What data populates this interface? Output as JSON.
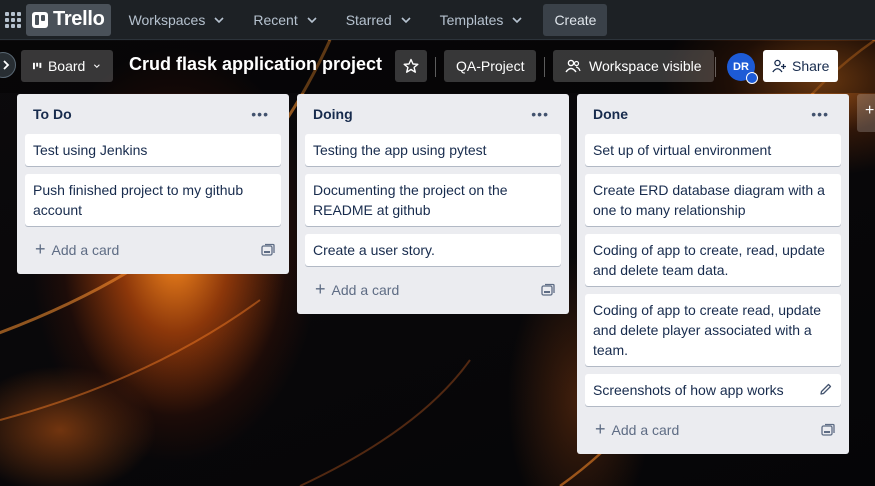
{
  "nav": {
    "logo": "Trello",
    "menus": [
      {
        "label": "Workspaces"
      },
      {
        "label": "Recent"
      },
      {
        "label": "Starred"
      },
      {
        "label": "Templates"
      }
    ],
    "create_label": "Create"
  },
  "board": {
    "view_label": "Board",
    "title": "Crud flask application project",
    "workspace_label": "QA-Project",
    "visibility_label": "Workspace visible",
    "avatar_initials": "DR",
    "share_label": "Share"
  },
  "lists": [
    {
      "title": "To Do",
      "cards": [
        "Test using Jenkins",
        "Push finished project to my github account"
      ],
      "add_label": "Add a card"
    },
    {
      "title": "Doing",
      "cards": [
        "Testing the app using pytest",
        "Documenting the project on the README at github",
        "Create a user story."
      ],
      "add_label": "Add a card"
    },
    {
      "title": "Done",
      "cards": [
        "Set up of virtual environment",
        "Create ERD database diagram with a one to many relationship",
        "Coding of app to create, read, update and delete team data.",
        "Coding of app to create read, update and delete player associated with a team.",
        "Screenshots of how app works"
      ],
      "add_label": "Add a card"
    }
  ],
  "colors": {
    "nav_bg": "#1d2125",
    "list_bg": "#ebecf0",
    "avatar_bg": "#1d5bd6"
  }
}
